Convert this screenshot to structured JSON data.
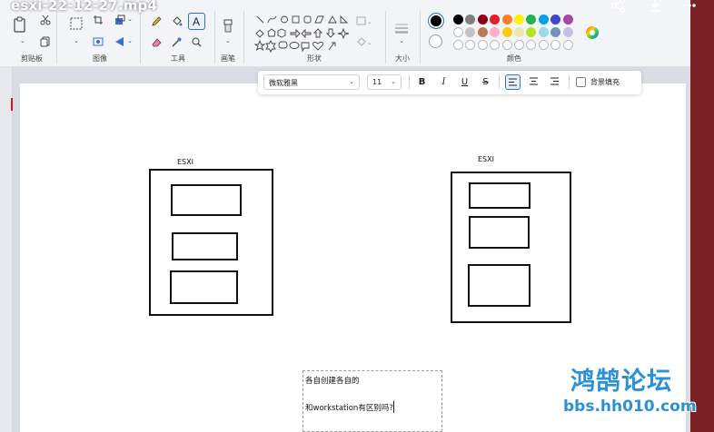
{
  "video": {
    "title": "esxi-22-12-27.mp4"
  },
  "top_icons": [
    "share-icon",
    "download-icon",
    "more-icon"
  ],
  "ribbon": {
    "groups": [
      {
        "key": "clipboard",
        "label": "剪贴板"
      },
      {
        "key": "image",
        "label": "图像"
      },
      {
        "key": "tools",
        "label": "工具"
      },
      {
        "key": "brushes",
        "label": "画笔"
      },
      {
        "key": "shapes",
        "label": "形状"
      },
      {
        "key": "size",
        "label": "大小"
      },
      {
        "key": "colors",
        "label": "颜色"
      }
    ],
    "colors": {
      "row1": [
        "#000000",
        "#7f7f7f",
        "#880015",
        "#ed1c24",
        "#ff7f27",
        "#fff200",
        "#22b14c",
        "#00a2e8",
        "#3f48cc",
        "#a349a4"
      ],
      "row2": [
        "#ffffff",
        "#c3c3c3",
        "#b97a57",
        "#ffaec9",
        "#ffc90e",
        "#efe4b0",
        "#b5e61d",
        "#99d9ea",
        "#7092be",
        "#c8bfe7"
      ]
    }
  },
  "text_toolbar": {
    "font": "微软雅黑",
    "size": "11",
    "bold": "B",
    "italic": "I",
    "underline": "U",
    "strike": "S",
    "fill_label": "背景填充"
  },
  "canvas": {
    "left_label": "ESXI",
    "right_label": "ESXI"
  },
  "textbox": {
    "line1": "各自创建各自的",
    "line2": "和workstation有区别吗?"
  },
  "watermark": {
    "title": "鸿鹄论坛",
    "url": "bbs.hh010.com"
  }
}
